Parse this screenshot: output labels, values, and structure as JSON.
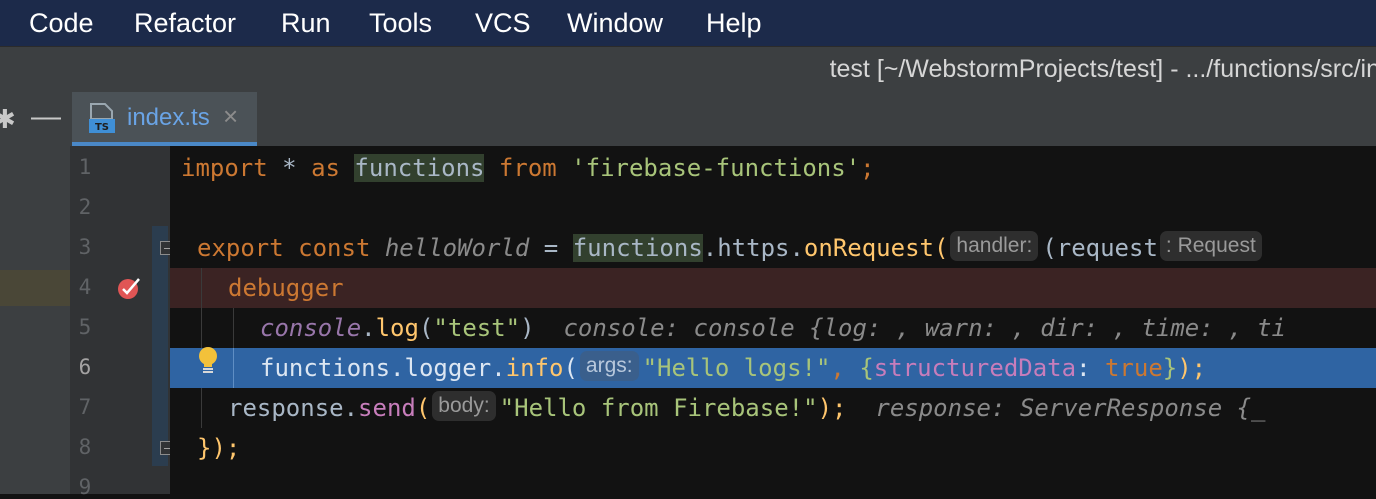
{
  "menu": [
    "Code",
    "Refactor",
    "Run",
    "Tools",
    "VCS",
    "Window",
    "Help"
  ],
  "title_bar": {
    "title": "test [~/WebstormProjects/test] - .../functions/src/in"
  },
  "tab": {
    "icon_text": "TS",
    "label": "index.ts",
    "close_glyph": "×"
  },
  "line_numbers": [
    "1",
    "2",
    "3",
    "4",
    "5",
    "6",
    "7",
    "8",
    "9"
  ],
  "code": {
    "l1": {
      "import": "import",
      "star": " * ",
      "as": "as",
      "functions": "functions",
      "from": "from",
      "module": "'firebase-functions'",
      "end": ";"
    },
    "l3": {
      "export": "export",
      "const": "const",
      "name": "helloWorld",
      "eq": " = ",
      "functions": "functions",
      "https": ".https.",
      "onRequest": "onRequest",
      "paren": "(",
      "hint": "handler:",
      "params": "(request",
      "hint2": ": Request"
    },
    "l4": {
      "debugger": "debugger"
    },
    "l5": {
      "console": "console",
      "dot": ".",
      "log": "log",
      "open": "(",
      "arg": "\"test\"",
      "close": ")",
      "inline": "console: console {log: , warn: , dir: , time: , ti"
    },
    "l6": {
      "prefix": "functions.logger.",
      "info": "info",
      "open": "(",
      "hint": "args:",
      "arg": "\"Hello logs!\"",
      "comma": ", ",
      "brace_open": "{",
      "key": "structuredData",
      "colon": ": ",
      "val": "true",
      "brace_close": "}",
      "end": ");"
    },
    "l7": {
      "response": "response.",
      "send": "send",
      "open": "(",
      "hint": "body:",
      "arg": "\"Hello from Firebase!\"",
      "end": ");",
      "inline": "response: ServerResponse {_"
    },
    "l8": {
      "close": "});"
    }
  },
  "colors": {
    "keyword": "#cc7832",
    "string": "#a8c47a",
    "function": "#ffc66d",
    "exec_line": "#2f64a3",
    "breakpoint_line": "#3b2323",
    "accent": "#4a88c7"
  },
  "icons": {
    "breakpoint": "breakpoint-check-icon",
    "intention": "lightbulb-icon",
    "ts_file": "typescript-file-icon"
  }
}
